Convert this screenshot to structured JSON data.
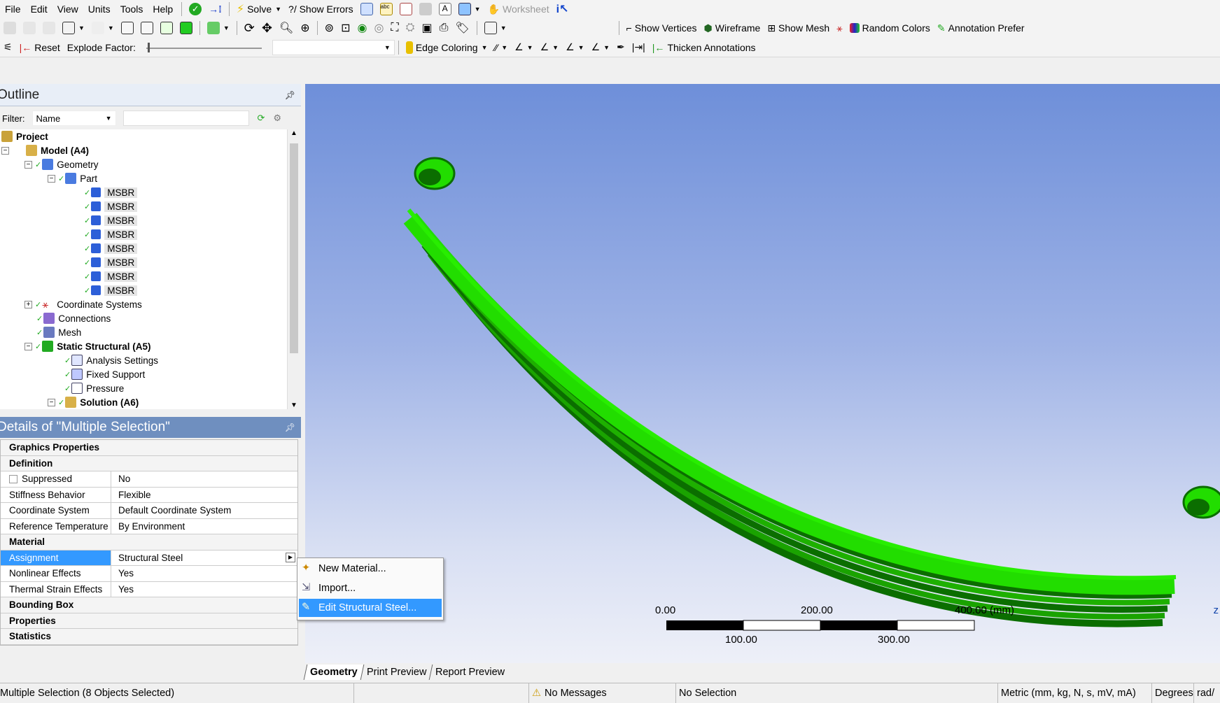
{
  "menu": [
    "File",
    "Edit",
    "View",
    "Units",
    "Tools",
    "Help"
  ],
  "toolbar1": {
    "solve_label": "Solve",
    "show_errors_label": "?/ Show Errors",
    "worksheet_label": "Worksheet"
  },
  "toolbar2": {
    "show_vertices_label": "Show Vertices",
    "wireframe_label": "Wireframe",
    "show_mesh_label": "Show Mesh",
    "random_colors_label": "Random Colors",
    "annotation_prefs_label": "Annotation Prefer"
  },
  "toolbar3": {
    "reset_label": "Reset",
    "explode_factor_label": "Explode Factor:",
    "edge_coloring_label": "Edge Coloring",
    "thicken_annotations_label": "Thicken Annotations"
  },
  "outline": {
    "title": "Outline",
    "filter_label": "Filter:",
    "filter_value": "Name",
    "tree": {
      "project": "Project",
      "model": "Model (A4)",
      "geometry": "Geometry",
      "part": "Part",
      "bodies": [
        "MSBR",
        "MSBR",
        "MSBR",
        "MSBR",
        "MSBR",
        "MSBR",
        "MSBR",
        "MSBR"
      ],
      "coordinate_systems": "Coordinate Systems",
      "connections": "Connections",
      "mesh": "Mesh",
      "static_structural": "Static Structural (A5)",
      "analysis_settings": "Analysis Settings",
      "fixed_support": "Fixed Support",
      "pressure": "Pressure",
      "solution": "Solution (A6)"
    }
  },
  "details": {
    "title": "Details of \"Multiple Selection\"",
    "sections": {
      "graphics": "Graphics Properties",
      "definition": "Definition",
      "material": "Material",
      "bounding_box": "Bounding Box",
      "properties": "Properties",
      "statistics": "Statistics"
    },
    "rows": {
      "suppressed": [
        "Suppressed",
        "No"
      ],
      "stiffness": [
        "Stiffness Behavior",
        "Flexible"
      ],
      "coord_system": [
        "Coordinate System",
        "Default Coordinate System"
      ],
      "ref_temp": [
        "Reference Temperature",
        "By Environment"
      ],
      "assignment": [
        "Assignment",
        "Structural Steel"
      ],
      "nonlinear": [
        "Nonlinear Effects",
        "Yes"
      ],
      "thermal": [
        "Thermal Strain Effects",
        "Yes"
      ]
    }
  },
  "context_menu": {
    "new_material": "New Material...",
    "import": "Import...",
    "edit": "Edit Structural Steel..."
  },
  "scale": {
    "top_labels": [
      "0.00",
      "200.00",
      "400.00 (mm)"
    ],
    "bottom_labels": [
      "100.00",
      "300.00"
    ]
  },
  "view_tabs": [
    "Geometry",
    "Print Preview",
    "Report Preview"
  ],
  "status": {
    "selection": "Multiple Selection (8 Objects Selected)",
    "messages": "No Messages",
    "no_selection": "No Selection",
    "units": "Metric (mm, kg, N, s, mV, mA)",
    "degrees": "Degrees",
    "rad": "rad/"
  },
  "colors": {
    "model_green": "#22dd00",
    "selection_blue": "#3399ff",
    "details_header": "#6f8fbf"
  }
}
